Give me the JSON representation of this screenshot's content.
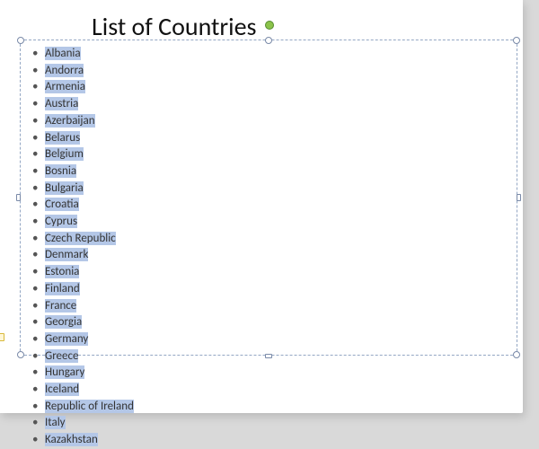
{
  "title": "List of Countries",
  "countries": [
    "Albania",
    "Andorra",
    "Armenia",
    "Austria",
    "Azerbaijan",
    "Belarus",
    "Belgium",
    "Bosnia",
    "Bulgaria",
    "Croatia",
    "Cyprus",
    "Czech Republic",
    "Denmark",
    "Estonia",
    "Finland",
    "France",
    "Georgia",
    "Germany",
    "Greece",
    "Hungary",
    "Iceland",
    "Republic of Ireland",
    "Italy",
    "Kazakhstan"
  ]
}
